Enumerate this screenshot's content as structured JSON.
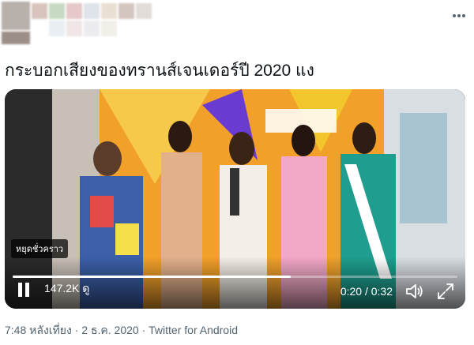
{
  "tweet": {
    "text": "กระบอกเสียงของทรานส์เจนเดอร์ปี 2020 แง"
  },
  "video": {
    "paused_badge": "หยุดชั่วคราว",
    "views": "147.2K ดู",
    "time": "0:20 / 0:32",
    "progress": 0.625
  },
  "meta": {
    "time": "7:48 หลังเที่ยง",
    "sep1": " · ",
    "date": "2 ธ.ค. 2020",
    "sep2": " · ",
    "source": "Twitter for Android"
  },
  "icons": {
    "more": "more-icon",
    "pause": "pause-icon",
    "volume": "volume-icon",
    "fullscreen": "fullscreen-icon"
  }
}
